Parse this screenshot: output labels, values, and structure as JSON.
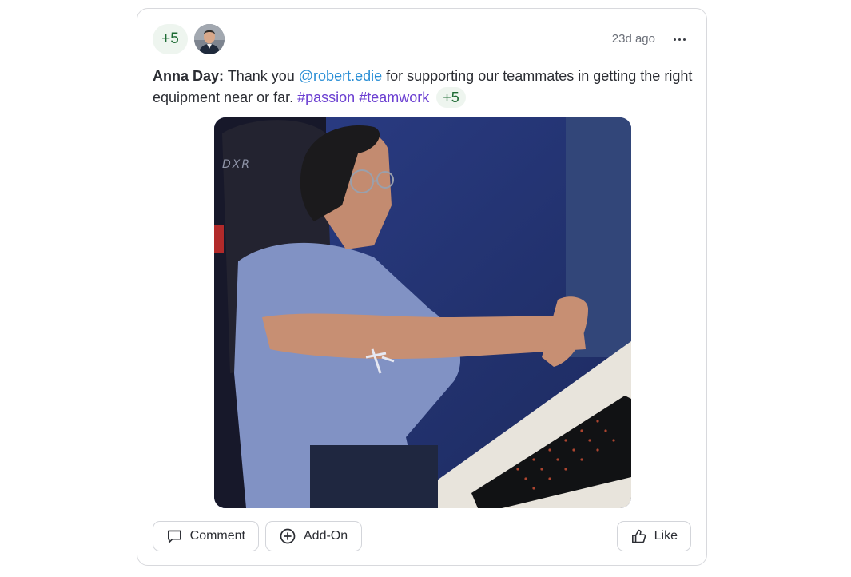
{
  "post": {
    "points_badge": "+5",
    "avatar_alt": "Profile photo",
    "timestamp": "23d ago",
    "more_icon": "more-horizontal-icon",
    "message": {
      "author": "Anna Day:",
      "text_1": "Thank you",
      "mention": "@robert.edie",
      "text_2": "for supporting our teammates in getting the right equipment near or far.",
      "hashtags": [
        "#passion",
        "#teamwork"
      ],
      "points": "+5"
    },
    "media": {
      "type": "gif",
      "chair_brand": "DXR"
    }
  },
  "actions": {
    "comment_label": "Comment",
    "comment_icon": "comment-icon",
    "addon_label": "Add-On",
    "addon_icon": "plus-circle-icon",
    "like_label": "Like",
    "like_icon": "thumbs-up-icon"
  },
  "colors": {
    "points_bg": "#eef5ef",
    "points_text": "#1e6b34",
    "mention": "#2a8fd6",
    "hashtag": "#6b3fd1",
    "border": "#d8d9dd"
  }
}
